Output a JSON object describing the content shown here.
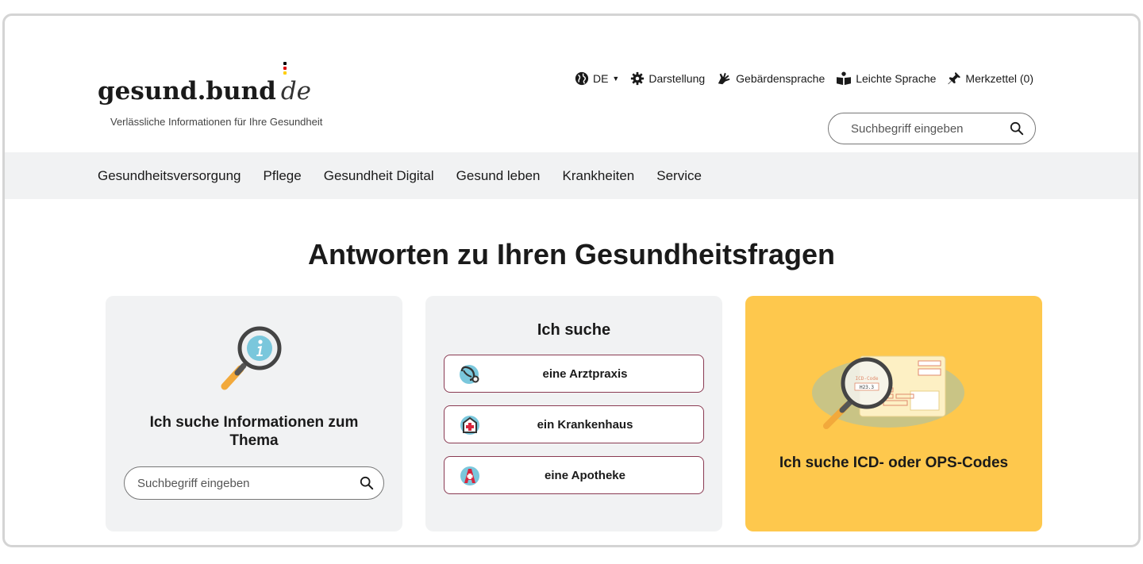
{
  "logo": {
    "brand": "gesund.bund",
    "tld": "de",
    "tagline": "Verlässliche Informationen für Ihre Gesundheit"
  },
  "topnav": {
    "language": "DE",
    "display": "Darstellung",
    "sign_language": "Gebärdensprache",
    "easy_language": "Leichte Sprache",
    "bookmarks": "Merkzettel (0)"
  },
  "header_search": {
    "placeholder": "Suchbegriff eingeben"
  },
  "mainnav": {
    "items": [
      "Gesundheitsversorgung",
      "Pflege",
      "Gesundheit Digital",
      "Gesund leben",
      "Krankheiten",
      "Service"
    ]
  },
  "headline": "Antworten zu Ihren Gesundheitsfragen",
  "card_info": {
    "title": "Ich suche Informationen zum Thema",
    "search_placeholder": "Suchbegriff eingeben"
  },
  "card_search": {
    "title": "Ich suche",
    "choices": [
      "eine Arztpraxis",
      "ein Krankenhaus",
      "eine Apotheke"
    ]
  },
  "card_codes": {
    "title": "Ich suche ICD- oder OPS-Codes",
    "illustration_label": "ICD-Code",
    "illustration_code": "H23.3"
  },
  "colors": {
    "accent_yellow": "#fec84d",
    "choice_border": "#8a3a52",
    "nav_bg": "#f1f2f3"
  },
  "icons": [
    "globe-icon",
    "gear-icon",
    "sign-language-icon",
    "easy-language-icon",
    "pin-icon",
    "search-icon",
    "magnifier-info-icon",
    "stethoscope-icon",
    "hospital-icon",
    "pharmacy-icon"
  ]
}
